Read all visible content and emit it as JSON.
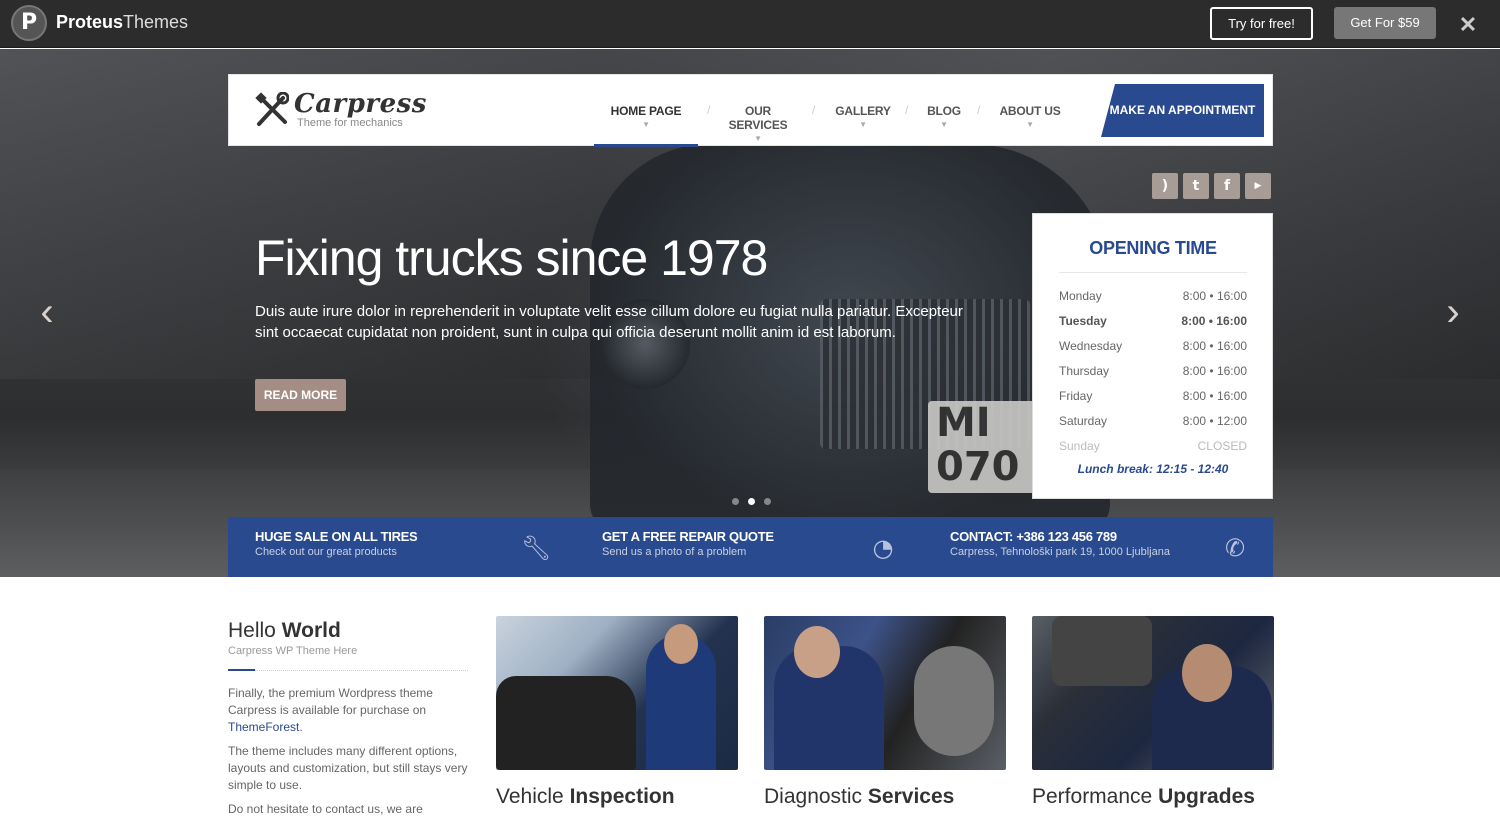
{
  "topbar": {
    "logo_letter": "P",
    "brand_bold": "Proteus",
    "brand_light": "Themes",
    "try_label": "Try for free!",
    "get_label": "Get For $59",
    "close_label": "✕"
  },
  "header": {
    "logo_title": "Carpress",
    "logo_sub": "Theme for mechanics",
    "nav": [
      {
        "label": "HOME PAGE"
      },
      {
        "label": "OUR SERVICES"
      },
      {
        "label": "GALLERY"
      },
      {
        "label": "BLOG"
      },
      {
        "label": "ABOUT US"
      }
    ],
    "appointment_label": "MAKE AN APPOINTMENT"
  },
  "social": [
    "rss-icon",
    "twitter-icon",
    "facebook-icon",
    "youtube-icon"
  ],
  "hero": {
    "title": "Fixing trucks since 1978",
    "text": "Duis aute irure dolor in reprehenderit in voluptate velit esse cillum dolore eu fugiat nulla pariatur. Excepteur sint occaecat cupidatat non proident, sunt in culpa qui officia deserunt mollit anim id est laborum.",
    "read_more": "READ MORE",
    "plate": "MI 070",
    "active_slide": 2,
    "slide_count": 3
  },
  "opening": {
    "title": "OPENING TIME",
    "rows": [
      {
        "day": "Monday",
        "time": "8:00 • 16:00"
      },
      {
        "day": "Tuesday",
        "time": "8:00 • 16:00"
      },
      {
        "day": "Wednesday",
        "time": "8:00 • 16:00"
      },
      {
        "day": "Thursday",
        "time": "8:00 • 16:00"
      },
      {
        "day": "Friday",
        "time": "8:00 • 16:00"
      },
      {
        "day": "Saturday",
        "time": "8:00 • 12:00"
      },
      {
        "day": "Sunday",
        "time": "CLOSED"
      }
    ],
    "lunch": "Lunch break: 12:15 - 12:40"
  },
  "infobar": [
    {
      "title": "HUGE SALE ON ALL TIRES",
      "sub": "Check out our great products",
      "icon": "wrench-icon"
    },
    {
      "title": "GET A FREE REPAIR QUOTE",
      "sub": "Send us a photo of a problem",
      "icon": "gauge-icon"
    },
    {
      "title": "CONTACT: +386 123 456 789",
      "sub": "Carpress, Tehnološki park 19, 1000 Ljubljana",
      "icon": "phone-icon"
    }
  ],
  "hello": {
    "title_light": "Hello",
    "title_bold": "World",
    "sub": "Carpress WP Theme Here",
    "p1_before": "Finally, the premium Wordpress theme Carpress is available for purchase on",
    "p1_link": "ThemeForest",
    "p1_after": ".",
    "p2": "The theme includes many different options, layouts and customization, but still stays very simple to use.",
    "p3": "Do not hesitate to contact us, we are"
  },
  "cards": [
    {
      "light": "Vehicle",
      "bold": "Inspection"
    },
    {
      "light": "Diagnostic",
      "bold": "Services"
    },
    {
      "light": "Performance",
      "bold": "Upgrades"
    }
  ],
  "colors": {
    "accent": "#2a4a8f",
    "button_brown": "#a48d84",
    "social_bg": "#a79d96",
    "topbar_bg": "#2c2c2c"
  }
}
